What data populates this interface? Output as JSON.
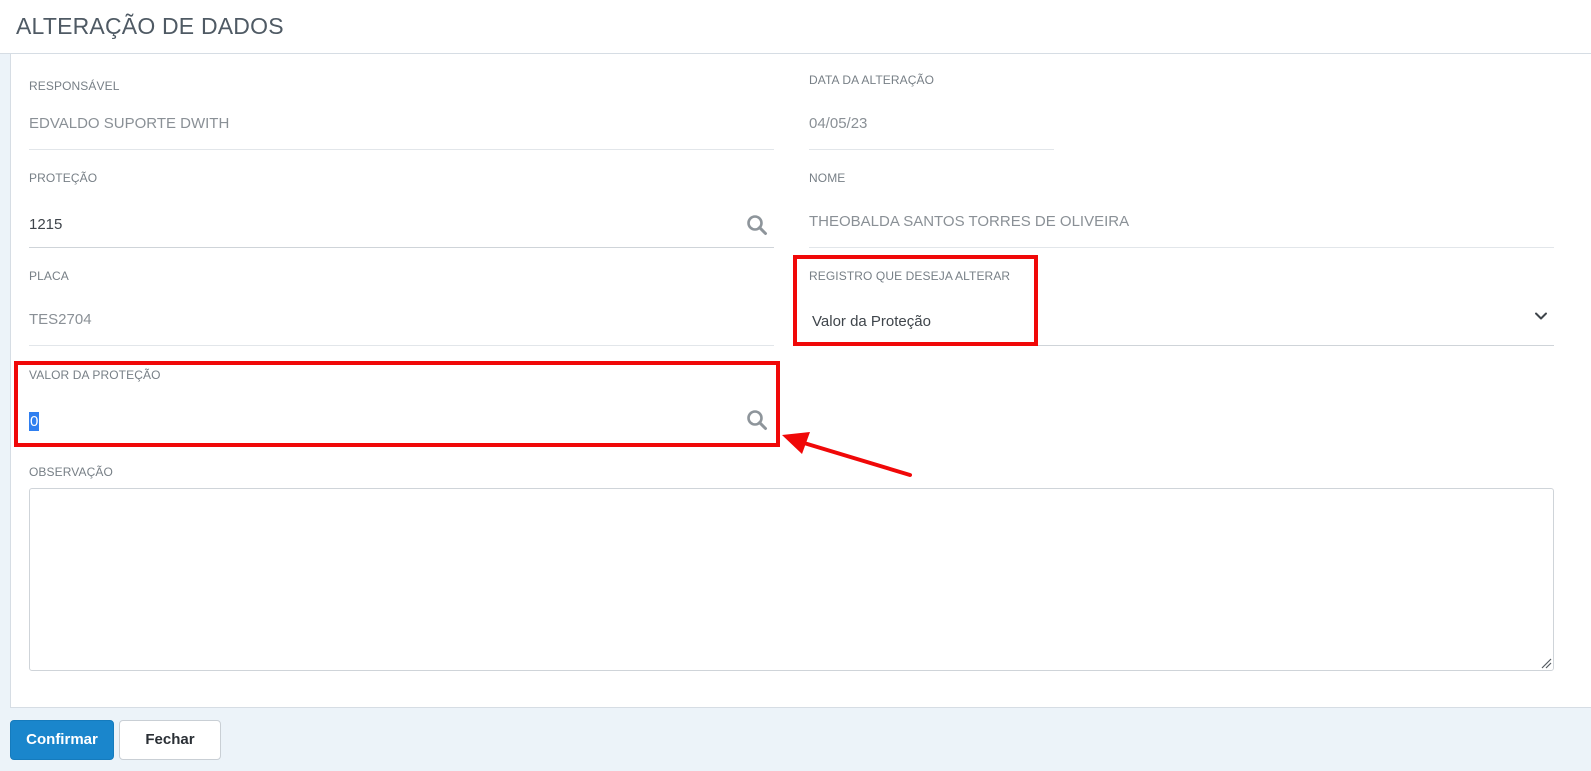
{
  "header": {
    "title": "ALTERAÇÃO DE DADOS"
  },
  "form": {
    "responsavel": {
      "label": "RESPONSÁVEL",
      "value": "EDVALDO SUPORTE DWITH"
    },
    "data_alteracao": {
      "label": "DATA DA ALTERAÇÃO",
      "value": "04/05/23"
    },
    "protecao": {
      "label": "PROTEÇÃO",
      "value": "1215",
      "icon": "search-icon"
    },
    "nome": {
      "label": "NOME",
      "value": "THEOBALDA SANTOS TORRES DE OLIVEIRA"
    },
    "placa": {
      "label": "PLACA",
      "value": "TES2704"
    },
    "registro": {
      "label": "REGISTRO QUE DESEJA ALTERAR",
      "selected": "Valor da Proteção",
      "icon": "chevron-down-icon"
    },
    "valor_protecao": {
      "label": "VALOR DA PROTEÇÃO",
      "value": "0",
      "icon": "search-icon"
    },
    "observacao": {
      "label": "OBSERVAÇÃO",
      "value": ""
    }
  },
  "buttons": {
    "confirm": "Confirmar",
    "close": "Fechar"
  },
  "colors": {
    "primary": "#1a86cc",
    "annotation": "#f00808",
    "selection": "#2f7ff0",
    "background": "#ecf3f9"
  }
}
